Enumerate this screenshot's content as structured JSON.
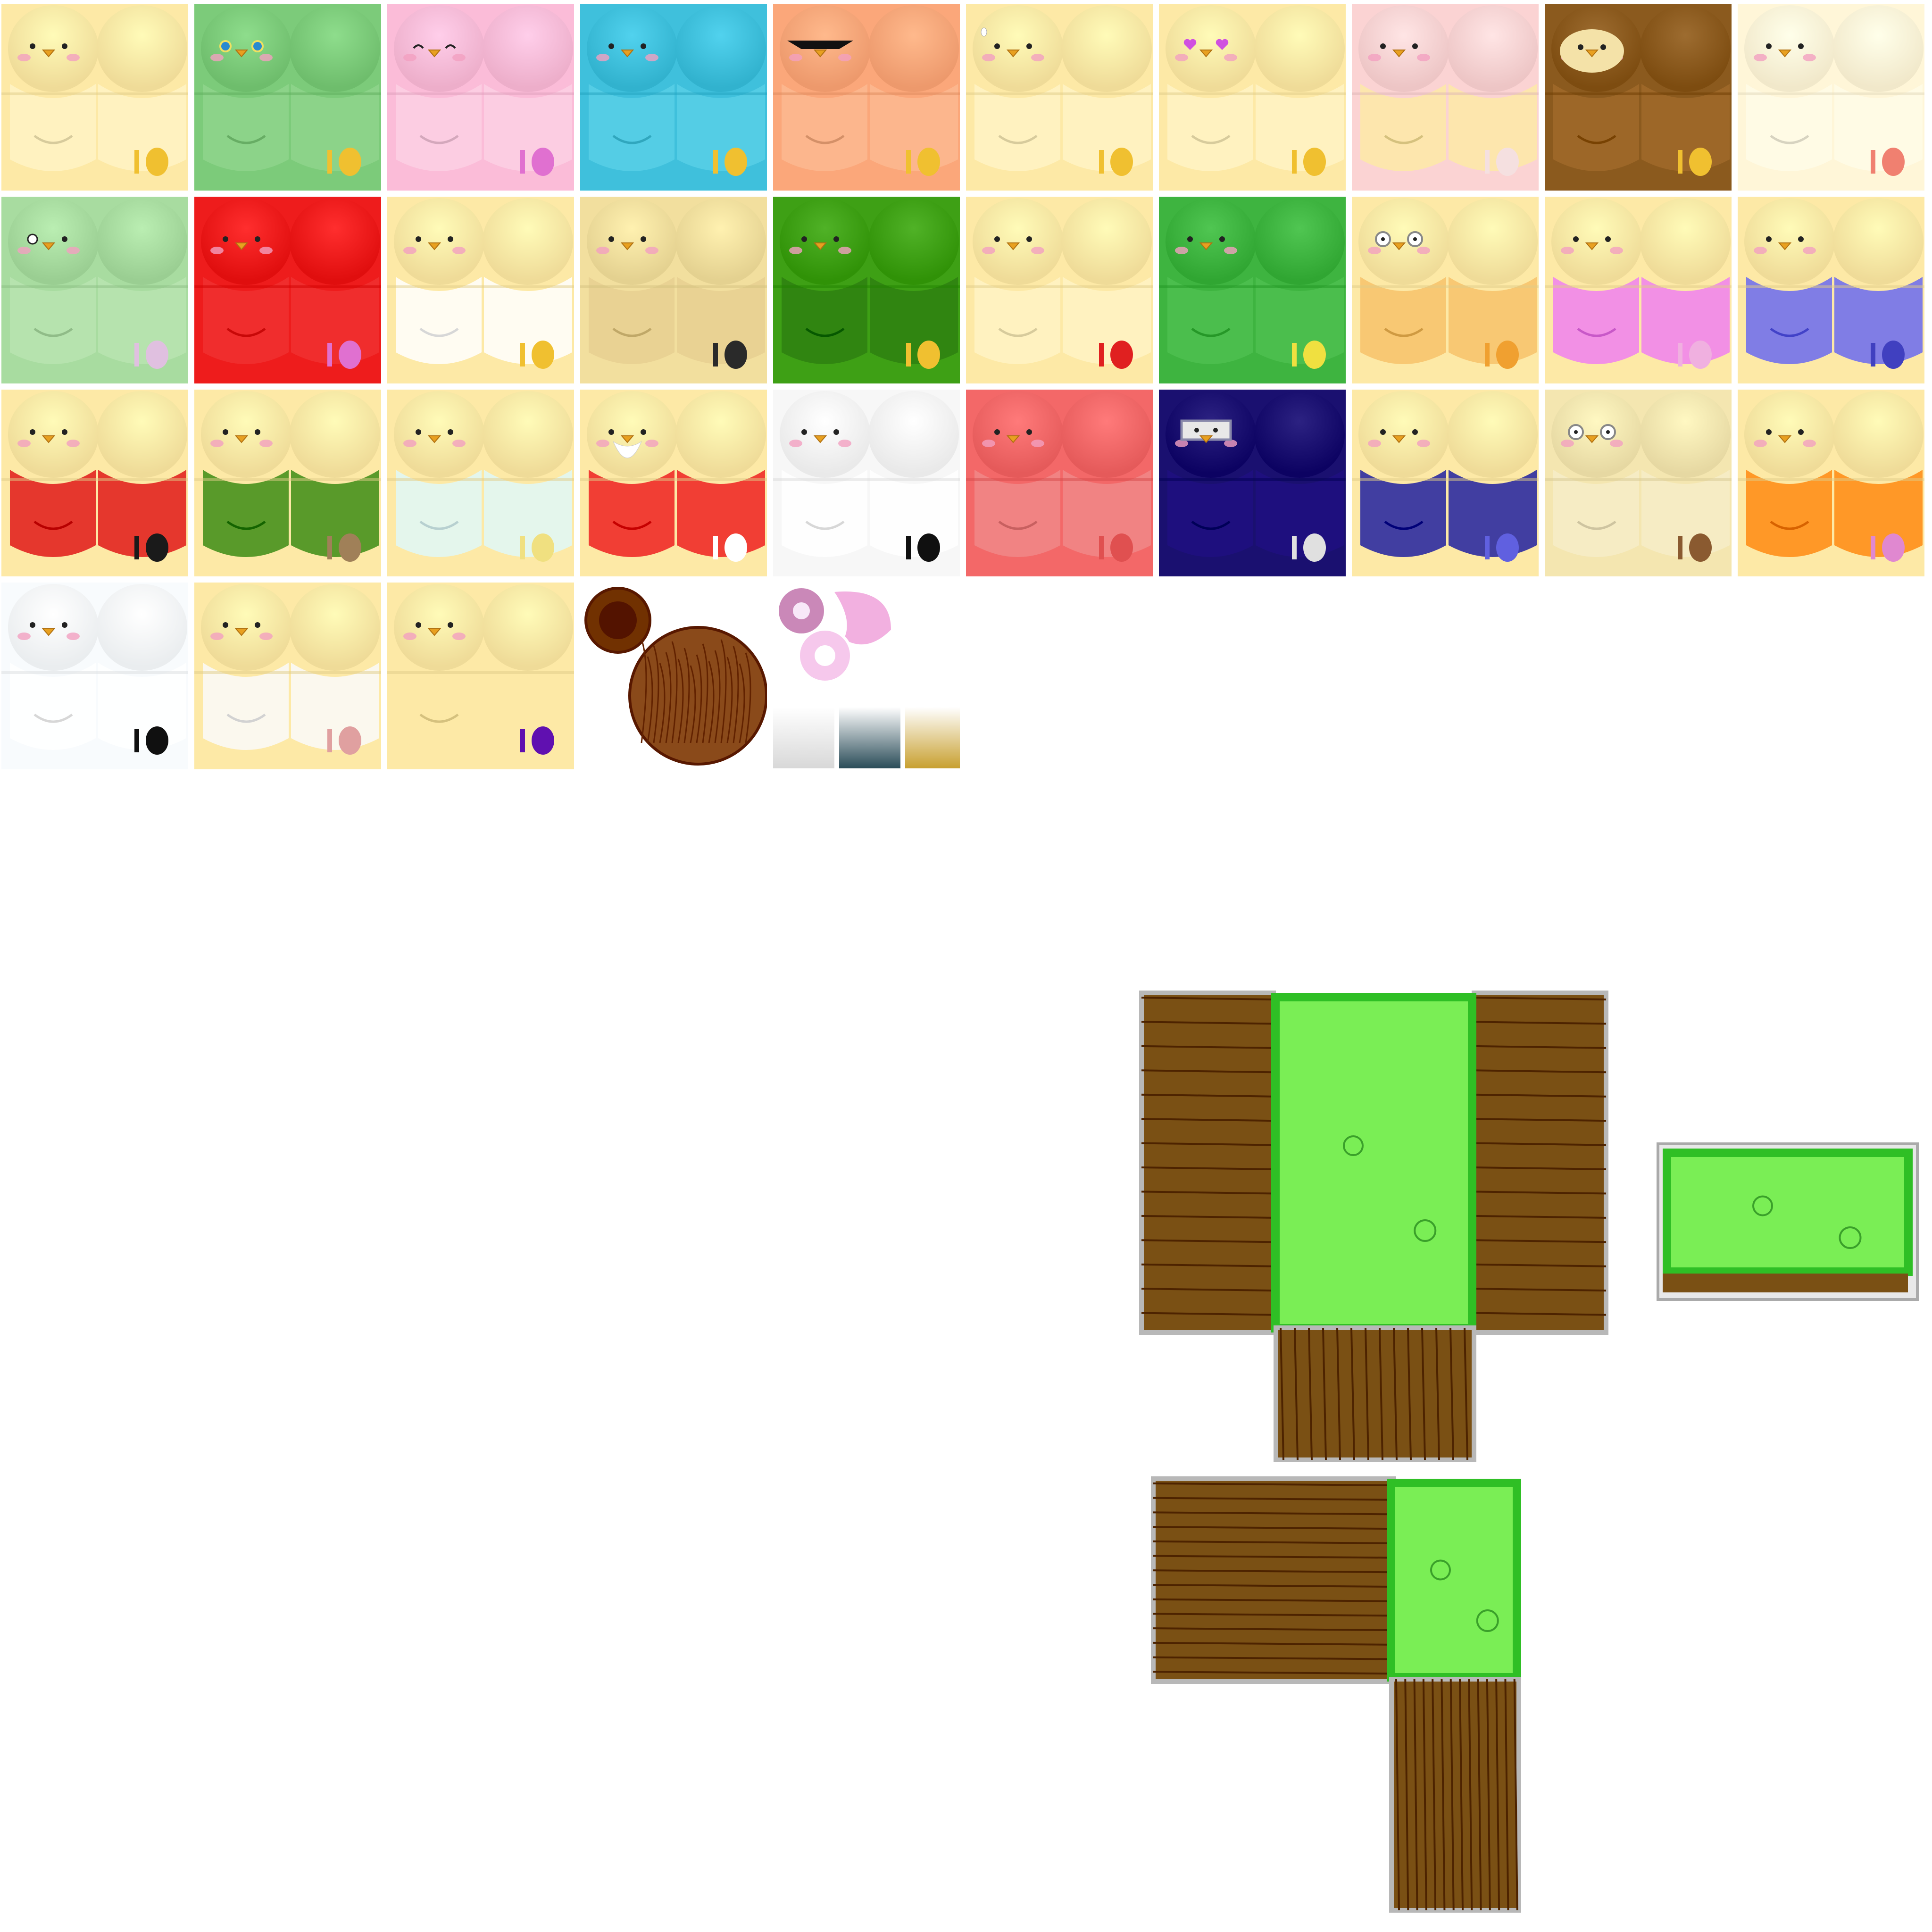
{
  "texture_atlas": {
    "background": "#ffffff",
    "skins": [
      {
        "name": "classic-yellow",
        "body": "#fde9a6",
        "belly": "#fff3c4",
        "eyes": "dots",
        "accent": "#f0c030"
      },
      {
        "name": "green-sparkle",
        "body": "#7ccb7a",
        "belly": "#8fd58c",
        "eyes": "sparkle",
        "accent": "#f0c030"
      },
      {
        "name": "pink",
        "body": "#fbbcd8",
        "belly": "#fcd0e4",
        "eyes": "happy",
        "accent": "#e070d0"
      },
      {
        "name": "blue",
        "body": "#3fc0dc",
        "belly": "#58cfe6",
        "eyes": "dots",
        "accent": "#f0c030"
      },
      {
        "name": "orange-sunglasses",
        "body": "#fba77a",
        "belly": "#fcb890",
        "eyes": "sunglasses",
        "accent": "#f0c030"
      },
      {
        "name": "yellow-sweat",
        "body": "#fde9a6",
        "belly": "#fff3c4",
        "eyes": "sweat",
        "accent": "#f0c030"
      },
      {
        "name": "yellow-heart-eyes",
        "body": "#fde9a6",
        "belly": "#fff3c4",
        "eyes": "hearts",
        "accent": "#f0c030"
      },
      {
        "name": "pink-yellow-face",
        "body": "#fbd3d3",
        "belly": "#fde9a6",
        "eyes": "dots",
        "accent": "#f5e0e0"
      },
      {
        "name": "brown-owl",
        "body": "#8b5a1e",
        "belly": "#a06a2a",
        "eyes": "owl",
        "accent": "#f0c030"
      },
      {
        "name": "white-chicken",
        "body": "#fff6d8",
        "belly": "#fffbe8",
        "eyes": "dots",
        "accent": "#f08070"
      },
      {
        "name": "zombie-green",
        "body": "#a8dca0",
        "belly": "#b8e4b0",
        "eyes": "zombie",
        "accent": "#e0c0e0"
      },
      {
        "name": "red",
        "body": "#ee1c1c",
        "belly": "#f03030",
        "eyes": "dots",
        "accent": "#e070d0"
      },
      {
        "name": "white-diaper",
        "body": "#fde9a6",
        "belly": "#ffffff",
        "eyes": "dots",
        "accent": "#f0c030"
      },
      {
        "name": "muscle",
        "body": "#f2df9e",
        "belly": "#e8d090",
        "eyes": "dots",
        "accent": "#2a2a2a"
      },
      {
        "name": "watermelon",
        "body": "#3ea015",
        "belly": "#2e8010",
        "eyes": "dots",
        "accent": "#f0c030"
      },
      {
        "name": "yellow-teeth",
        "body": "#fde9a6",
        "belly": "#fff3c4",
        "eyes": "dots",
        "accent": "#e02020"
      },
      {
        "name": "green-pineapple",
        "body": "#3eb440",
        "belly": "#4ec050",
        "eyes": "dots",
        "accent": "#f0e040"
      },
      {
        "name": "yellow-stripes",
        "body": "#fde9a6",
        "belly": "#f7c26a",
        "eyes": "glasses",
        "accent": "#f0a030"
      },
      {
        "name": "pink-sailor",
        "body": "#fde9a6",
        "belly": "#f080f0",
        "eyes": "dots",
        "accent": "#f0b0e0"
      },
      {
        "name": "blue-sailor",
        "body": "#fde9a6",
        "belly": "#6a6af0",
        "eyes": "dots",
        "accent": "#4040c0"
      },
      {
        "name": "royal-guard",
        "body": "#fde9a6",
        "belly": "#e01818",
        "eyes": "dots",
        "accent": "#1a1a1a"
      },
      {
        "name": "camo",
        "body": "#fde9a6",
        "belly": "#3c8c14",
        "eyes": "dots",
        "accent": "#a08058"
      },
      {
        "name": "pajamas",
        "body": "#fde9a6",
        "belly": "#dff8f8",
        "eyes": "dots",
        "accent": "#f0e080"
      },
      {
        "name": "santa-stripe",
        "body": "#fde9a6",
        "belly": "#ee2020",
        "eyes": "beard",
        "accent": "#ffffff"
      },
      {
        "name": "dalmatian",
        "body": "#f7f7f7",
        "belly": "#ffffff",
        "eyes": "dots",
        "accent": "#101010"
      },
      {
        "name": "red-cap",
        "body": "#f36868",
        "belly": "#f08888",
        "eyes": "dots",
        "accent": "#e05050"
      },
      {
        "name": "ninja",
        "body": "#1a1070",
        "belly": "#200f80",
        "eyes": "ninja",
        "accent": "#e0e0e0"
      },
      {
        "name": "blue-overalls",
        "body": "#fde9a6",
        "belly": "#2020a0",
        "eyes": "dots",
        "accent": "#6060e0"
      },
      {
        "name": "grandpa",
        "body": "#f4e6b0",
        "belly": "#f6ecc8",
        "eyes": "glasses",
        "accent": "#8a5a30"
      },
      {
        "name": "orange-bandana",
        "body": "#fde9a6",
        "belly": "#ff8a10",
        "eyes": "dots",
        "accent": "#e088d0"
      },
      {
        "name": "white-ghost",
        "body": "#f8fbfd",
        "belly": "#ffffff",
        "eyes": "dots",
        "accent": "#101010"
      },
      {
        "name": "white-shirt",
        "body": "#fde9a6",
        "belly": "#fafafa",
        "eyes": "dots",
        "accent": "#e0a0a0"
      },
      {
        "name": "witch-hair",
        "body": "#fde9a6",
        "belly": "#fde9a6",
        "eyes": "dots",
        "accent": "#6010b0"
      }
    ],
    "props": [
      {
        "name": "wooden-bowl",
        "color": "#8a4a1a"
      },
      {
        "name": "donut-pieces",
        "color": "#f2b0e0"
      },
      {
        "name": "gradient-swatches",
        "colors": [
          "#d8d8d8",
          "#2a4c58",
          "#c8a030"
        ]
      }
    ],
    "blocks": [
      {
        "name": "grass-block-large",
        "grass": "#7aee55",
        "wood": "#7a5014"
      },
      {
        "name": "grass-block-small",
        "grass": "#7aee55",
        "wood": "#7a5014"
      },
      {
        "name": "grass-block-tall",
        "grass": "#7aee55",
        "wood": "#7a5014"
      }
    ]
  }
}
